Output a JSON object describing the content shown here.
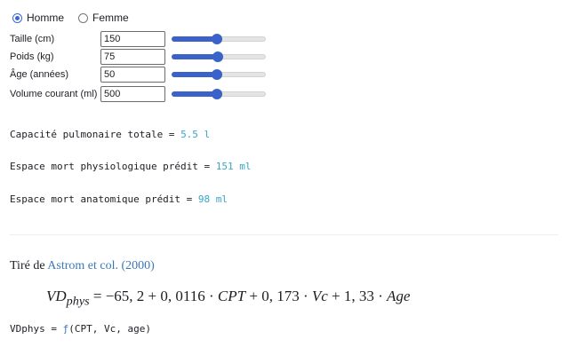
{
  "sex": {
    "options": [
      {
        "label": "Homme",
        "checked": true
      },
      {
        "label": "Femme",
        "checked": false
      }
    ]
  },
  "fields": [
    {
      "label": "Taille (cm)",
      "value": "150",
      "slider_fraction": 0.48
    },
    {
      "label": "Poids (kg)",
      "value": "75",
      "slider_fraction": 0.49
    },
    {
      "label": "Âge (années)",
      "value": "50",
      "slider_fraction": 0.48
    },
    {
      "label": "Volume courant (ml)",
      "value": "500",
      "slider_fraction": 0.48
    }
  ],
  "results": [
    {
      "label": "Capacité pulmonaire totale = ",
      "value": "5.5 l"
    },
    {
      "label": "Espace mort physiologique prédit = ",
      "value": "151 ml"
    },
    {
      "label": "Espace mort anatomique prédit = ",
      "value": "98 ml"
    }
  ],
  "source": {
    "prefix": "Tiré de ",
    "link": "Astrom et col. (2000)"
  },
  "formula": {
    "lhs": "VD",
    "lhs_sub": "phys",
    "rhs": " = −65, 2 + 0, 0116 · ",
    "v1": "CPT",
    "mid": " + 0, 173 · ",
    "v2": "Vc",
    "tail": " + 1, 33 · ",
    "v3": "Age"
  },
  "code": {
    "prefix": "VDphys = ",
    "fn": "ƒ",
    "args": "(CPT, Vc, age)"
  },
  "colors": {
    "accent": "#3a62c8",
    "value": "#36a6c6",
    "link": "#3b78b8"
  }
}
